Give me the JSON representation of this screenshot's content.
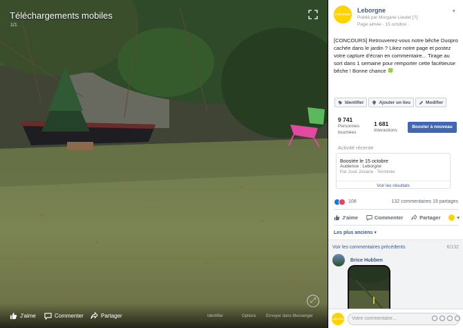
{
  "viewer": {
    "album_title": "Téléchargements mobiles",
    "album_count": "1/1",
    "bottom_actions": [
      {
        "label": "J'aime",
        "icon": "thumbs-up-icon"
      },
      {
        "label": "Commenter",
        "icon": "comment-icon"
      },
      {
        "label": "Partager",
        "icon": "share-icon"
      }
    ],
    "bottom_meta": [
      "Identifier",
      "Options",
      "Envoyer dans Messenger"
    ]
  },
  "post": {
    "page_name": "Leborgne",
    "published_by": "Publié par Morgane Lieutet [?] ·",
    "liked": "Page aimée · 15 octobre ·",
    "text": "[CONCOURS] Retrouverez-vous notre bêche Duopro cachée dans le jardin ? Likez notre page et postez votre capture d'écran en commentaire... Tirage au sort dans 1 semaine pour remporter cette facétieuse bêche ! Bonne chance 🍀",
    "tools": [
      {
        "label": "Identifier",
        "icon": "tag-icon"
      },
      {
        "label": "Ajouter un lieu",
        "icon": "location-pin-icon"
      },
      {
        "label": "Modifier",
        "icon": "pencil-icon"
      }
    ]
  },
  "stats": {
    "people_count": "9 741",
    "people_label": "Personnes touchées",
    "interactions_count": "1 681",
    "interactions_label": "Interactions",
    "boost_button": "Booster à nouveau"
  },
  "activity": {
    "title": "Activité récente",
    "line1": "Boostée le 15 octobre",
    "line2": "Audience : Leborgne",
    "line3": "Par José Josiane · Terminée",
    "link": "Voir les résultats"
  },
  "reactions": {
    "count": "108",
    "comments_shares": "132 commentaires  19 partages",
    "colors": {
      "like": "#1877f2",
      "love": "#f33e58"
    }
  },
  "actions": [
    {
      "label": "J'aime",
      "icon": "thumbs-up-icon"
    },
    {
      "label": "Commenter",
      "icon": "comment-icon"
    },
    {
      "label": "Partager",
      "icon": "share-icon"
    }
  ],
  "comments": {
    "sort_label": "Les plus anciens ▾",
    "previous_label": "Voir les commentaires précédents",
    "previous_count": "6/132",
    "first_author": "Brice Hubben",
    "composer_placeholder": "Votre commentaire..."
  },
  "logo_text": "LEBORGNE",
  "colors": {
    "accent": "#4267b2",
    "brand_yellow": "#ffd200",
    "link": "#385898"
  }
}
